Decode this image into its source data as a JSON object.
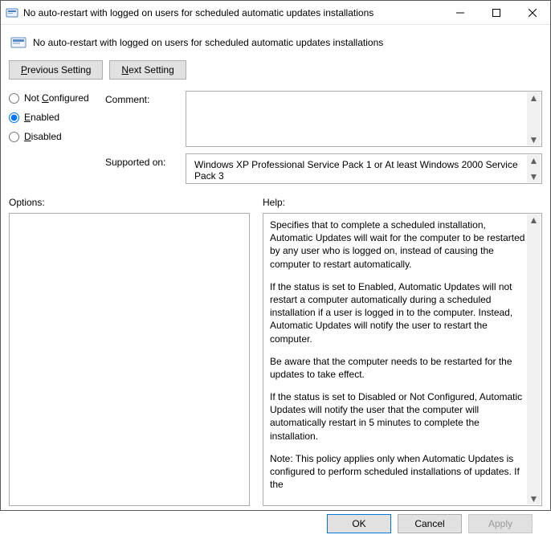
{
  "window": {
    "title": "No auto-restart with logged on users for scheduled automatic updates installations"
  },
  "header": {
    "policy_name": "No auto-restart with logged on users for scheduled automatic updates installations"
  },
  "nav": {
    "prev_prefix": "P",
    "prev_rest": "revious Setting",
    "next_prefix": "N",
    "next_rest": "ext Setting"
  },
  "state": {
    "not_configured": {
      "label_prefix": "Not ",
      "label_u": "C",
      "label_rest": "onfigured"
    },
    "enabled": {
      "label_u": "E",
      "label_rest": "nabled"
    },
    "disabled": {
      "label_u": "D",
      "label_rest": "isabled"
    }
  },
  "labels": {
    "comment": "Comment:",
    "supported": "Supported on:",
    "options": "Options:",
    "help": "Help:"
  },
  "supported_text": "Windows XP Professional Service Pack 1 or At least Windows 2000 Service Pack 3",
  "help": {
    "p1": "Specifies that to complete a scheduled installation, Automatic Updates will wait for the computer to be restarted by any user who is logged on, instead of causing the computer to restart automatically.",
    "p2": "If the status is set to Enabled, Automatic Updates will not restart a computer automatically during a scheduled installation if a user is logged in to the computer. Instead, Automatic Updates will notify the user to restart the computer.",
    "p3": "Be aware that the computer needs to be restarted for the updates to take effect.",
    "p4": "If the status is set to Disabled or Not Configured, Automatic Updates will notify the user that the computer will automatically restart in 5 minutes to complete the installation.",
    "p5": "Note: This policy applies only when Automatic Updates is configured to perform scheduled installations of updates. If the"
  },
  "buttons": {
    "ok": "OK",
    "cancel": "Cancel",
    "apply": "Apply"
  }
}
